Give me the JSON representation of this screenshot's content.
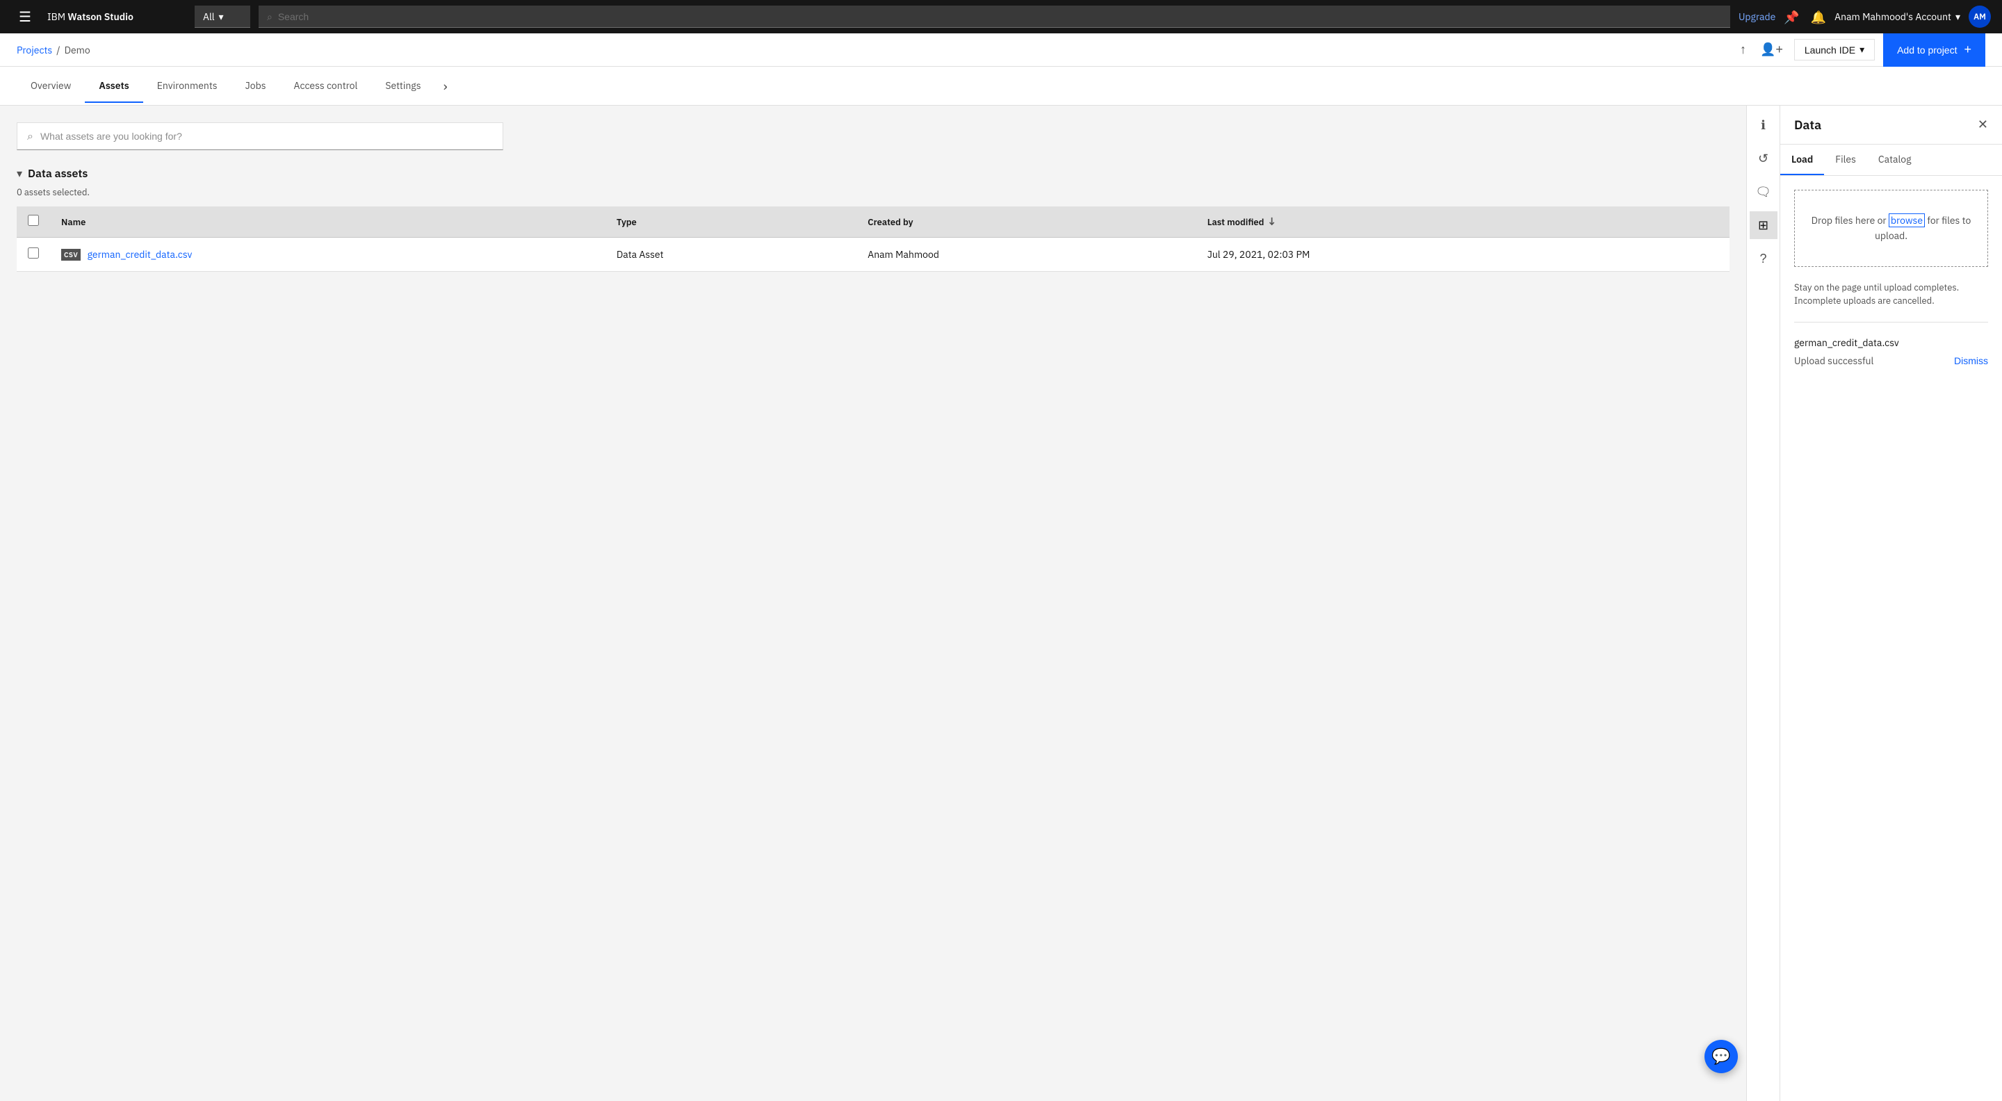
{
  "app": {
    "name": "IBM Watson Studio",
    "name_bold": "Watson Studio",
    "name_prefix": "IBM "
  },
  "topnav": {
    "all_label": "All",
    "search_placeholder": "Search",
    "upgrade_label": "Upgrade",
    "account_name": "Anam Mahmood's Account",
    "avatar_initials": "AM"
  },
  "subheader": {
    "breadcrumb_projects": "Projects",
    "breadcrumb_separator": "/",
    "breadcrumb_current": "Demo",
    "upload_icon": "↑",
    "add_collaborator_icon": "👤+",
    "launch_ide_label": "Launch IDE",
    "add_to_project_label": "Add to project",
    "add_icon": "+"
  },
  "tabs": {
    "items": [
      {
        "label": "Overview",
        "active": false
      },
      {
        "label": "Assets",
        "active": true
      },
      {
        "label": "Environments",
        "active": false
      },
      {
        "label": "Jobs",
        "active": false
      },
      {
        "label": "Access control",
        "active": false
      },
      {
        "label": "Settings",
        "active": false
      }
    ],
    "more_icon": "›"
  },
  "side_icons": [
    {
      "name": "info-icon",
      "symbol": "ℹ",
      "active": false
    },
    {
      "name": "history-icon",
      "symbol": "⟳",
      "active": false
    },
    {
      "name": "chat-icon",
      "symbol": "💬",
      "active": false
    },
    {
      "name": "grid-icon",
      "symbol": "⊞",
      "active": true
    },
    {
      "name": "help-icon",
      "symbol": "?",
      "active": false
    }
  ],
  "assets": {
    "search_placeholder": "What assets are you looking for?",
    "section_title": "Data assets",
    "assets_count": "0 assets selected.",
    "columns": [
      {
        "key": "name",
        "label": "Name"
      },
      {
        "key": "type",
        "label": "Type"
      },
      {
        "key": "created_by",
        "label": "Created by"
      },
      {
        "key": "last_modified",
        "label": "Last modified"
      }
    ],
    "rows": [
      {
        "badge": "CSV",
        "name": "german_credit_data.csv",
        "type": "Data Asset",
        "created_by": "Anam Mahmood",
        "last_modified": "Jul 29, 2021, 02:03 PM"
      }
    ]
  },
  "data_panel": {
    "title": "Data",
    "tabs": [
      {
        "label": "Load",
        "active": true
      },
      {
        "label": "Files",
        "active": false
      },
      {
        "label": "Catalog",
        "active": false
      }
    ],
    "drop_zone_text_before": "Drop files here or ",
    "drop_zone_browse": "browse",
    "drop_zone_text_after": " for files to upload.",
    "upload_note": "Stay on the page until upload completes. Incomplete uploads are cancelled.",
    "uploaded_file": "german_credit_data.csv",
    "upload_status": "Upload successful",
    "dismiss_label": "Dismiss"
  },
  "float_chat": {
    "icon": "💬"
  }
}
